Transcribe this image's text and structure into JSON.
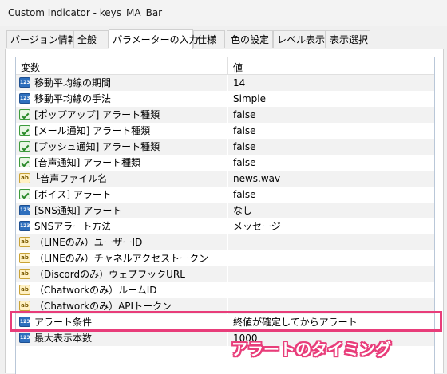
{
  "window": {
    "title": "Custom Indicator - keys_MA_Bar"
  },
  "tabs": [
    {
      "label": "バージョン情報"
    },
    {
      "label": "全般"
    },
    {
      "label": "パラメーターの入力",
      "active": true
    },
    {
      "label": "仕様"
    },
    {
      "label": "色の設定"
    },
    {
      "label": "レベル表示"
    },
    {
      "label": "表示選択"
    }
  ],
  "grid": {
    "columns": {
      "variable": "変数",
      "value": "値"
    },
    "rows": [
      {
        "icon": "number-icon",
        "name": "移動平均線の期間",
        "value": "14"
      },
      {
        "icon": "number-icon",
        "name": "移動平均線の手法",
        "value": "Simple"
      },
      {
        "icon": "boolean-icon",
        "name": "[ポップアップ] アラート種類",
        "value": "false"
      },
      {
        "icon": "boolean-icon",
        "name": "[メール通知] アラート種類",
        "value": "false"
      },
      {
        "icon": "boolean-icon",
        "name": "[プッシュ通知] アラート種類",
        "value": "false"
      },
      {
        "icon": "boolean-icon",
        "name": "[音声通知] アラート種類",
        "value": "false"
      },
      {
        "icon": "string-icon",
        "name": "└音声ファイル名",
        "value": "news.wav"
      },
      {
        "icon": "boolean-icon",
        "name": "[ボイス] アラート",
        "value": "false"
      },
      {
        "icon": "number-icon",
        "name": "[SNS通知] アラート",
        "value": "なし"
      },
      {
        "icon": "number-icon",
        "name": "SNSアラート方法",
        "value": "メッセージ"
      },
      {
        "icon": "string-icon",
        "name": "（LINEのみ）ユーザーID",
        "value": ""
      },
      {
        "icon": "string-icon",
        "name": "（LINEのみ）チャネルアクセストークン",
        "value": ""
      },
      {
        "icon": "string-icon",
        "name": "（Discordのみ）ウェブフックURL",
        "value": ""
      },
      {
        "icon": "string-icon",
        "name": "（Chatworkのみ）ルームID",
        "value": ""
      },
      {
        "icon": "string-icon",
        "name": "（Chatworkのみ）APIトークン",
        "value": ""
      },
      {
        "icon": "number-icon",
        "name": "アラート条件",
        "value": "終値が確定してからアラート"
      },
      {
        "icon": "number-icon",
        "name": "最大表示本数",
        "value": "1000"
      }
    ]
  },
  "annotation": {
    "text": "アラートのタイミング",
    "color": "#e83d7a"
  }
}
